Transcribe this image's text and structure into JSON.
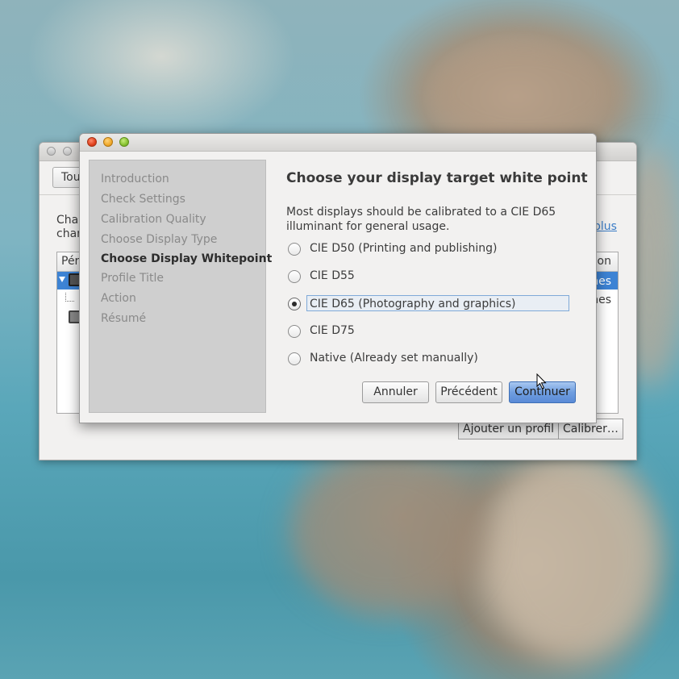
{
  "background_window": {
    "toolbar_button": "Tou",
    "text_line1": "Cha",
    "text_line2": "char",
    "link": "plus",
    "table_header_left": "Pér",
    "table_header_right": "tion",
    "row1_right": "nes",
    "row2_right": "nes",
    "buttons": [
      "Ajouter un profil",
      "Calibrer…"
    ]
  },
  "dialog": {
    "steps": [
      {
        "label": "Introduction",
        "active": false
      },
      {
        "label": "Check Settings",
        "active": false
      },
      {
        "label": "Calibration Quality",
        "active": false
      },
      {
        "label": "Choose Display Type",
        "active": false
      },
      {
        "label": "Choose Display Whitepoint",
        "active": true
      },
      {
        "label": "Profile Title",
        "active": false
      },
      {
        "label": "Action",
        "active": false
      },
      {
        "label": "Résumé",
        "active": false
      }
    ],
    "heading": "Choose your display target white point",
    "description": "Most displays should be calibrated to a CIE D65 illuminant for general usage.",
    "options": [
      {
        "label": "CIE D50 (Printing and publishing)",
        "checked": false
      },
      {
        "label": "CIE D55",
        "checked": false
      },
      {
        "label": "CIE D65 (Photography and graphics)",
        "checked": true
      },
      {
        "label": "CIE D75",
        "checked": false
      },
      {
        "label": "Native (Already set manually)",
        "checked": false
      }
    ],
    "buttons": {
      "cancel": "Annuler",
      "previous": "Précédent",
      "continue": "Continuer"
    }
  },
  "colors": {
    "selection": "#3d83d4",
    "primary_button": "#6f9ee0",
    "close": "#e0401d",
    "minimize": "#f0a92a",
    "maximize": "#86c12f"
  }
}
